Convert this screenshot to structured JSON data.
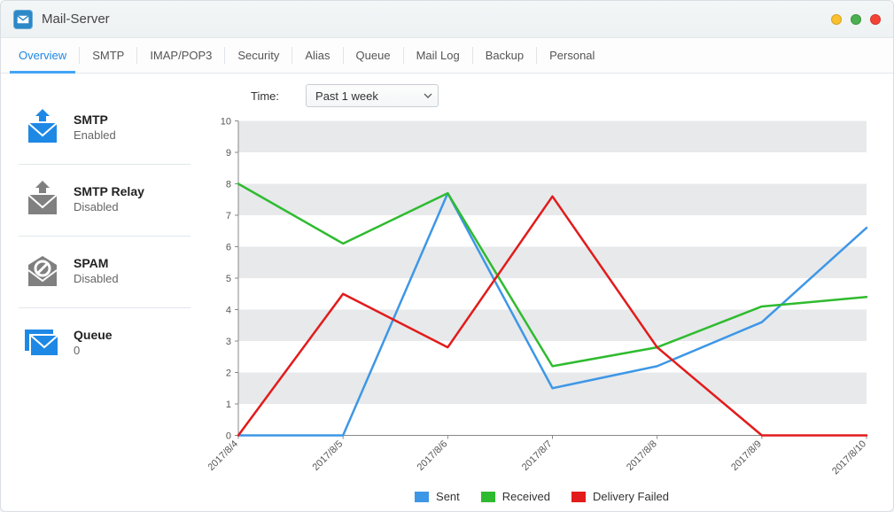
{
  "titlebar": {
    "title": "Mail-Server"
  },
  "tabs": [
    {
      "label": "Overview",
      "active": true
    },
    {
      "label": "SMTP"
    },
    {
      "label": "IMAP/POP3"
    },
    {
      "label": "Security"
    },
    {
      "label": "Alias"
    },
    {
      "label": "Queue"
    },
    {
      "label": "Mail Log"
    },
    {
      "label": "Backup"
    },
    {
      "label": "Personal"
    }
  ],
  "sidebar": {
    "items": [
      {
        "title": "SMTP",
        "status": "Enabled",
        "icon": "mail-up-icon",
        "color": "#1e88e5"
      },
      {
        "title": "SMTP Relay",
        "status": "Disabled",
        "icon": "mail-down-icon",
        "color": "#808080"
      },
      {
        "title": "SPAM",
        "status": "Disabled",
        "icon": "mail-block-icon",
        "color": "#808080"
      },
      {
        "title": "Queue",
        "status": "0",
        "icon": "mail-stack-icon",
        "color": "#1e88e5"
      }
    ]
  },
  "controls": {
    "time_label": "Time:",
    "time_value": "Past 1 week"
  },
  "legend": {
    "sent": "Sent",
    "received": "Received",
    "failed": "Delivery Failed"
  },
  "chart_data": {
    "type": "line",
    "x": [
      "2017/8/4",
      "2017/8/5",
      "2017/8/6",
      "2017/8/7",
      "2017/8/8",
      "2017/8/9",
      "2017/8/10"
    ],
    "y_ticks": [
      0,
      1,
      2,
      3,
      4,
      5,
      6,
      7,
      8,
      9,
      10
    ],
    "ylim": [
      0,
      10
    ],
    "series": [
      {
        "name": "Sent",
        "color": "#3e97e6",
        "values": [
          0,
          0,
          7.7,
          1.5,
          2.2,
          3.6,
          6.6
        ]
      },
      {
        "name": "Received",
        "color": "#2fbb2f",
        "values": [
          8,
          6.1,
          7.7,
          2.2,
          2.8,
          4.1,
          4.4
        ]
      },
      {
        "name": "Delivery Failed",
        "color": "#e21b1b",
        "values": [
          0,
          4.5,
          2.8,
          7.6,
          2.8,
          0,
          0
        ]
      }
    ],
    "title": "",
    "xlabel": "",
    "ylabel": ""
  }
}
